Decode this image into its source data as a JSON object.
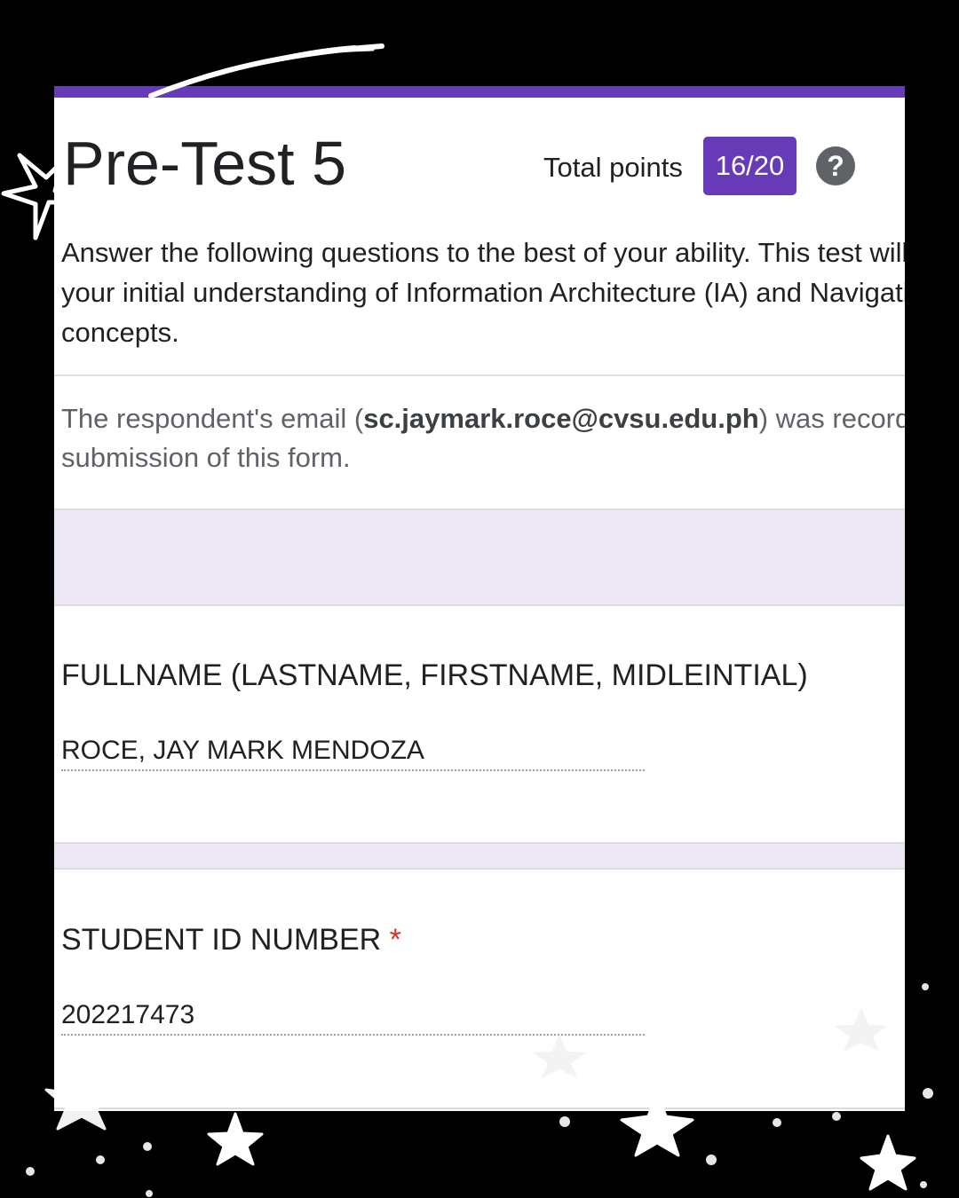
{
  "form": {
    "title": "Pre-Test 5",
    "accent_color": "#673ab7",
    "total_points_label": "Total points",
    "score": "16/20",
    "help_icon": "help-icon",
    "description": " Answer the following questions to the best of your ability. This test will assess your initial understanding of Information Architecture (IA) and Navigation Design concepts.",
    "email_note": {
      "prefix": "The respondent's email (",
      "email": "sc.jaymark.roce@cvsu.edu.ph",
      "suffix": ") was recorded on submission of this form."
    }
  },
  "questions": [
    {
      "title": "FULLNAME (LASTNAME, FIRSTNAME, MIDLEINTIAL)",
      "required_mark": "",
      "answer": "ROCE, JAY MARK MENDOZA"
    },
    {
      "title": "STUDENT ID NUMBER",
      "required_mark": "*",
      "answer": "202217473"
    }
  ]
}
